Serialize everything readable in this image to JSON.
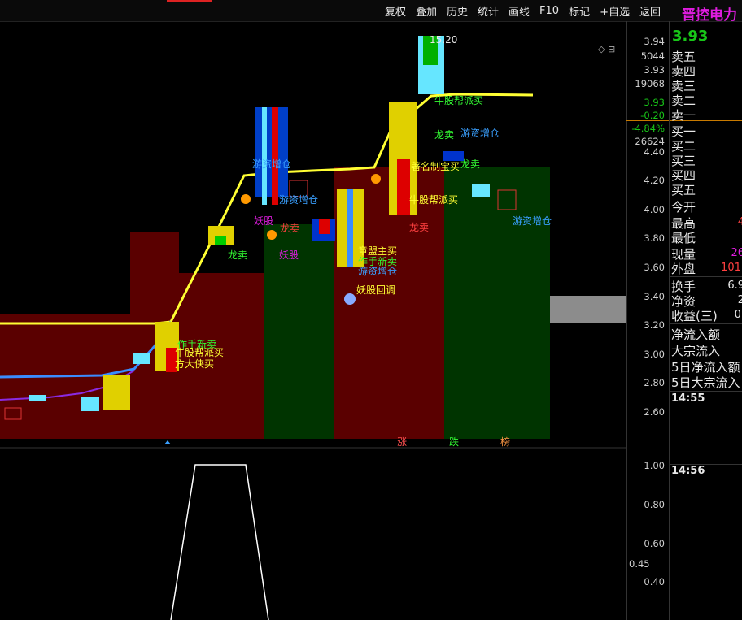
{
  "menu": [
    "复权",
    "叠加",
    "历史",
    "统计",
    "画线",
    "F10",
    "标记",
    "+自选",
    "返回"
  ],
  "stock": {
    "name": "晋控电力",
    "price": "3.93"
  },
  "price_axis": [
    "3.94",
    "3.93",
    "-4.84%",
    "4.40",
    "4.20",
    "4.00",
    "3.80",
    "3.60",
    "3.40",
    "3.20",
    "3.00",
    "2.80",
    "2.60"
  ],
  "book_vals": [
    "5044",
    "19068",
    "-0.20",
    "26624"
  ],
  "osc_axis": [
    "1.00",
    "0.80",
    "0.60",
    "0.45",
    "0.40"
  ],
  "book": [
    "卖五",
    "卖四",
    "卖三",
    "卖二",
    "卖一",
    "买一",
    "买二",
    "买三",
    "买四",
    "买五"
  ],
  "stats": [
    {
      "label": "今开",
      "value": ""
    },
    {
      "label": "最高",
      "value": "4"
    },
    {
      "label": "最低",
      "value": ""
    },
    {
      "label": "现量",
      "value": "26"
    },
    {
      "label": "外盘",
      "value": "101."
    }
  ],
  "stats2": [
    {
      "label": "换手",
      "value": "6.9"
    },
    {
      "label": "净资",
      "value": "2"
    },
    {
      "label": "收益(三)",
      "value": "0."
    }
  ],
  "flows": [
    "净流入额",
    "大宗流入",
    "5日净流入额",
    "5日大宗流入"
  ],
  "times": [
    "14:55",
    "14:56"
  ],
  "annotations": {
    "high_price": "15.20",
    "signals": [
      "龙卖",
      "妖股",
      "游资增仓",
      "牛股帮派买",
      "方大侠买",
      "作手新卖",
      "著名制宝买",
      "妖股回调",
      "章盟主买",
      "游资增仓"
    ],
    "bottom_tags": [
      "涨",
      "跌",
      "榜"
    ]
  }
}
